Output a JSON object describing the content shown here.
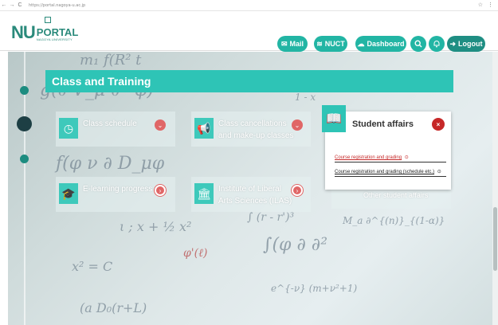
{
  "browser": {
    "back": "←",
    "forward": "→",
    "reload": "C",
    "url": "https://portal.nagoya-u.ac.jp",
    "right_icons": [
      "☆",
      "⋮"
    ]
  },
  "header": {
    "logo_nu": "NU",
    "logo_portal": "PORTAL",
    "logo_sub": "NAGOYA UNIVERSITY",
    "buttons": {
      "mail": "Mail",
      "nuct": "NUCT",
      "dashboard": "Dashboard",
      "logout": "Logout"
    },
    "icons": {
      "mail": "✉",
      "nuct": "≋",
      "dashboard": "☁",
      "search": "🔍",
      "bell": "🔔",
      "logout": "➜"
    }
  },
  "section": {
    "title": "Class and Training"
  },
  "tiles": [
    {
      "label": "Class schedule",
      "icon": "◷",
      "arrow": "⌄"
    },
    {
      "label": "Class cancellations and make-up classes",
      "icon": "📢",
      "arrow": "⌄"
    },
    {
      "label": "E-learning progress",
      "icon": "🎓",
      "arrow": "›"
    },
    {
      "label": "Institute of Liberal Arts Sciences (ILAS)",
      "icon": "🏛",
      "arrow": "›"
    }
  ],
  "popup": {
    "title": "Student affairs",
    "icon": "📖",
    "close": "×",
    "links": [
      {
        "label": "Course registration and grading",
        "icon": "⊙"
      },
      {
        "label": "Course registration and grading (schedule etc.)",
        "icon": "⊙"
      }
    ],
    "partial_label": "Other student affairs"
  },
  "colors": {
    "brand": "#2a8a7b",
    "teal": "#2ec4b6",
    "button": "#22b5a4",
    "danger": "#c62828",
    "arrow": "#e06666"
  }
}
